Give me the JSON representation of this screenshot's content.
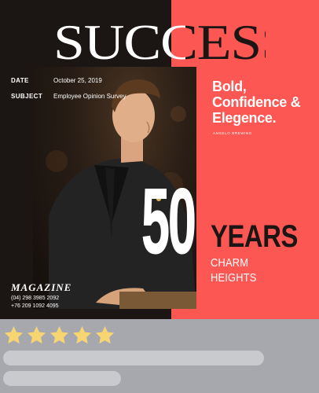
{
  "masthead": {
    "title": "SUCCESS"
  },
  "details": {
    "date_label": "DATE",
    "date_value": "October 25, 2019",
    "subject_label": "SUBJECT",
    "subject_value": "Employee  Opinion Survey"
  },
  "headline": {
    "line1": "Bold,",
    "line2": "Confidence &",
    "line3": "Elegence."
  },
  "author": "ANGELO BREWING",
  "anniversary": {
    "number": "50",
    "unit": "YEARS",
    "tag1": "CHARM",
    "tag2": "HEIGHTS"
  },
  "footer": {
    "magazine": "MAGAZINE",
    "phone1": "(04) 298 3985 2092",
    "phone2": "+76 209 1092 4095"
  },
  "rating": {
    "stars": 5,
    "max": 5
  },
  "colors": {
    "dark": "#1b1614",
    "coral": "#fc5752",
    "star": "#f6d572",
    "placeholder_bar": "#c8cacd",
    "panel_bg": "#a6a8ae"
  },
  "icons": {
    "rating_star": "star-icon"
  }
}
